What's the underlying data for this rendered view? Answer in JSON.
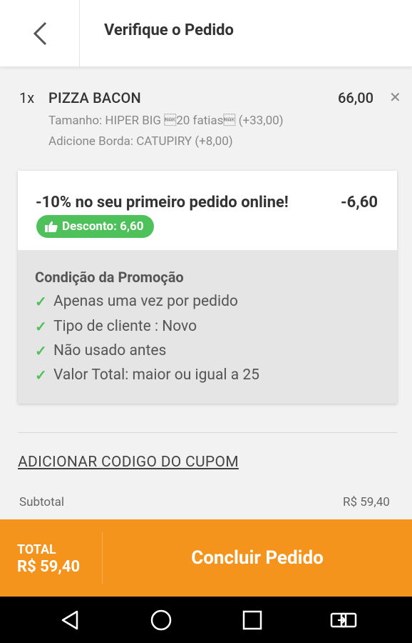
{
  "header": {
    "title": "Verifique o Pedido",
    "back_icon": "chevron-left-icon"
  },
  "order_item": {
    "quantity": "1x",
    "name": "PIZZA BACON",
    "price": "66,00",
    "remove_icon": "close-icon",
    "options": [
      "Tamanho: HIPER BIG \u001520 fatias\u0015 (+33,00)",
      "Adicione Borda: CATUPIRY (+8,00)"
    ]
  },
  "promotion": {
    "title": "-10% no seu primeiro pedido online!",
    "amount": "-6,60",
    "badge": "Desconto: 6,60",
    "badge_icon": "thumbs-up-icon",
    "badge_color": "#4ec15a",
    "condition_title": "Condição da Promoção",
    "conditions": [
      "Apenas uma vez por pedido",
      "Tipo de cliente : Novo",
      "Não usado antes",
      "Valor Total: maior ou igual a 25"
    ],
    "check_icon": "check-icon"
  },
  "coupon": {
    "link": "ADICIONAR CODIGO DO CUPOM"
  },
  "summary": {
    "subtotal_label": "Subtotal",
    "subtotal_value": "R$ 59,40"
  },
  "footer": {
    "total_label": "TOTAL",
    "total_value": "R$ 59,40",
    "checkout_label": "Concluir Pedido",
    "color": "#f5941d"
  },
  "navbar": {
    "icons": [
      "back-triangle-icon",
      "home-circle-icon",
      "recents-square-icon",
      "rotate-screen-icon"
    ]
  }
}
